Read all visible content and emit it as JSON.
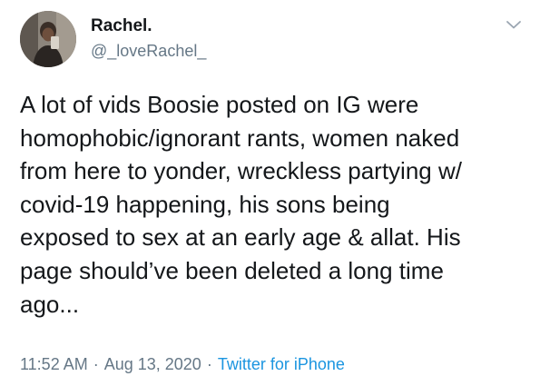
{
  "author": {
    "display_name": "Rachel.",
    "handle": "@_loveRachel_"
  },
  "icons": {
    "menu": "chevron-down-icon",
    "avatar": "profile-avatar"
  },
  "colors": {
    "text_primary": "#14171a",
    "text_secondary": "#657786",
    "link": "#1b95e0",
    "chevron": "#9aa5b1"
  },
  "tweet": {
    "text": "A lot of vids Boosie posted on IG were\nhomophobic/ignorant rants, women naked\nfrom here to yonder, wreckless partying w/\ncovid-19 happening, his sons being\nexposed to sex at an early age & allat. His\npage should’ve been deleted a long time\nago...",
    "time": "11:52 AM",
    "date": "Aug 13, 2020",
    "source": "Twitter for iPhone",
    "separator": "·"
  }
}
